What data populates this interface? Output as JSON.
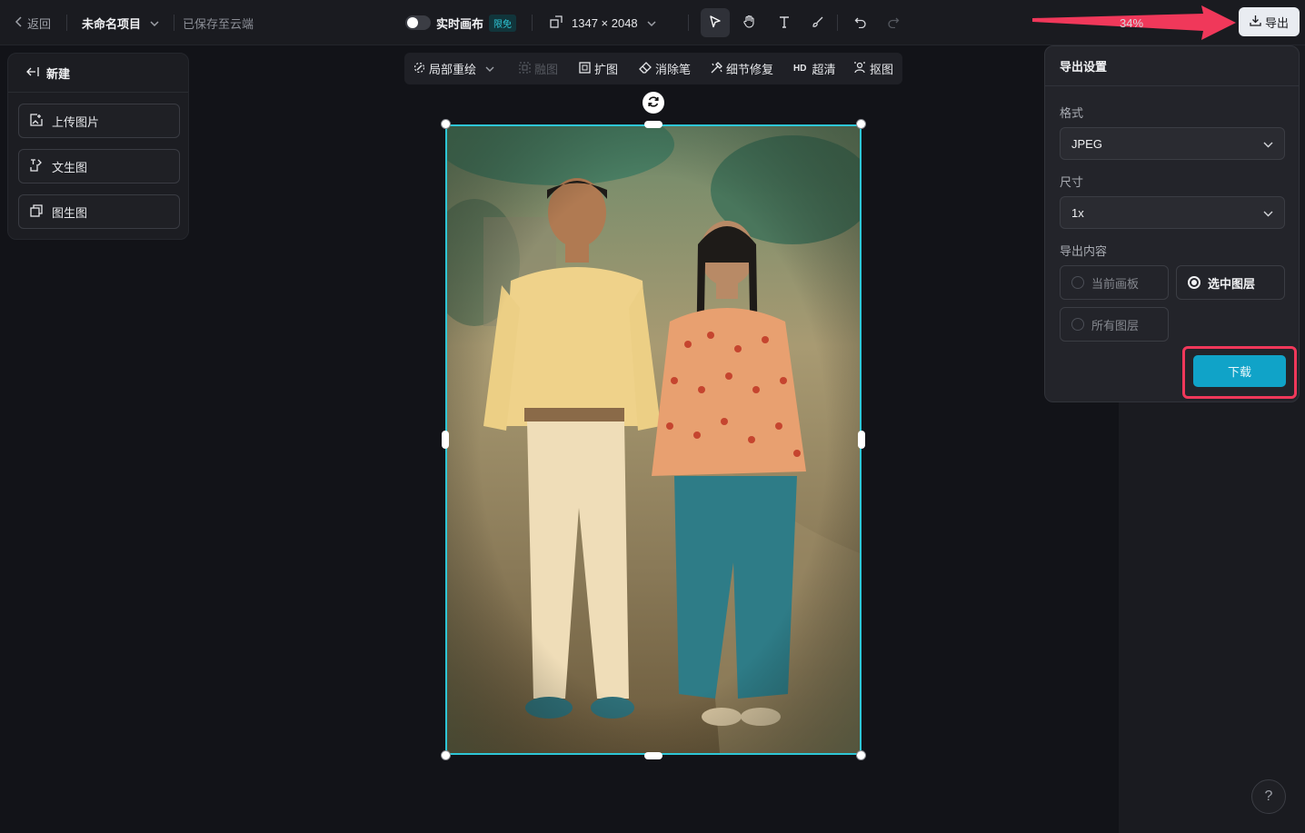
{
  "topbar": {
    "back_label": "返回",
    "project_name": "未命名项目",
    "saved_status": "已保存至云端",
    "realtime_label": "实时画布",
    "realtime_badge": "限免",
    "canvas_size": "1347 × 2048",
    "zoom": "34%",
    "export_label": "导出"
  },
  "left_panel": {
    "header": "新建",
    "buttons": [
      "上传图片",
      "文生图",
      "图生图"
    ]
  },
  "edit_tools": {
    "items": [
      "局部重绘",
      "融图",
      "扩图",
      "消除笔",
      "细节修复",
      "超清",
      "抠图"
    ],
    "hd_prefix": "HD"
  },
  "export_dialog": {
    "title": "导出设置",
    "format_label": "格式",
    "format_value": "JPEG",
    "size_label": "尺寸",
    "size_value": "1x",
    "content_label": "导出内容",
    "options": [
      "当前画板",
      "选中图层",
      "所有图层"
    ],
    "selected_option": "选中图层",
    "download_label": "下载"
  },
  "help": "?",
  "colors": {
    "accent": "#10a3c8",
    "selection": "#2ec6d6",
    "highlight": "#f0385a"
  }
}
